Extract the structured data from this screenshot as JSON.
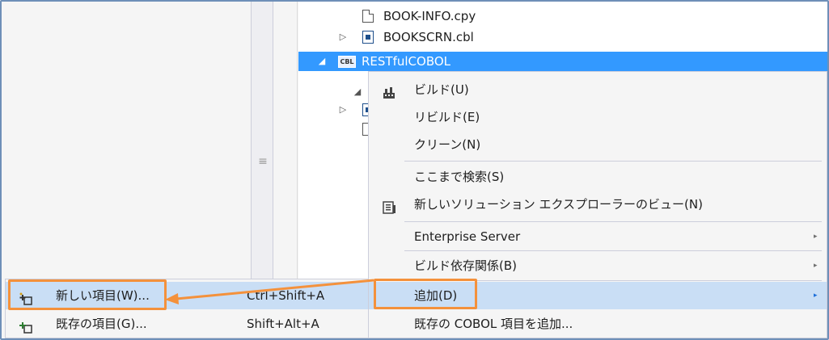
{
  "tree": {
    "items": [
      {
        "arrow": "",
        "label": "BOOK-INFO.cpy",
        "icon": "copybook-file-icon"
      },
      {
        "arrow": "▷",
        "label": "BOOKSCRN.cbl",
        "icon": "screen-file-icon"
      },
      {
        "arrow": "◢",
        "label": "RESTfulCOBOL",
        "icon": "cobol-project-icon",
        "icon_text": "CBL",
        "selected": true
      }
    ]
  },
  "splitter": {
    "grip": "≡"
  },
  "context_menu": {
    "items": [
      {
        "label": "ビルド(U)",
        "icon": "build-icon"
      },
      {
        "label": "リビルド(E)"
      },
      {
        "label": "クリーン(N)"
      },
      {
        "label": "ここまで検索(S)"
      },
      {
        "label": "新しいソリューション エクスプローラーのビュー(N)",
        "icon": "new-view-icon"
      },
      {
        "label": "Enterprise Server",
        "submenu": "▸"
      },
      {
        "label": "ビルド依存関係(B)",
        "submenu": "▸"
      },
      {
        "label": "追加(D)",
        "submenu": "▸",
        "active": true
      },
      {
        "label": "既存の COBOL 項目を追加..."
      }
    ]
  },
  "add_submenu": {
    "items": [
      {
        "label": "新しい項目(W)...",
        "shortcut": "Ctrl+Shift+A",
        "icon": "new-item-icon",
        "active": true
      },
      {
        "label": "既存の項目(G)...",
        "shortcut": "Shift+Alt+A",
        "icon": "existing-item-icon"
      }
    ]
  },
  "colors": {
    "selection": "#3399ff",
    "highlight": "#f4913b",
    "menu_hover": "#c9def5"
  }
}
